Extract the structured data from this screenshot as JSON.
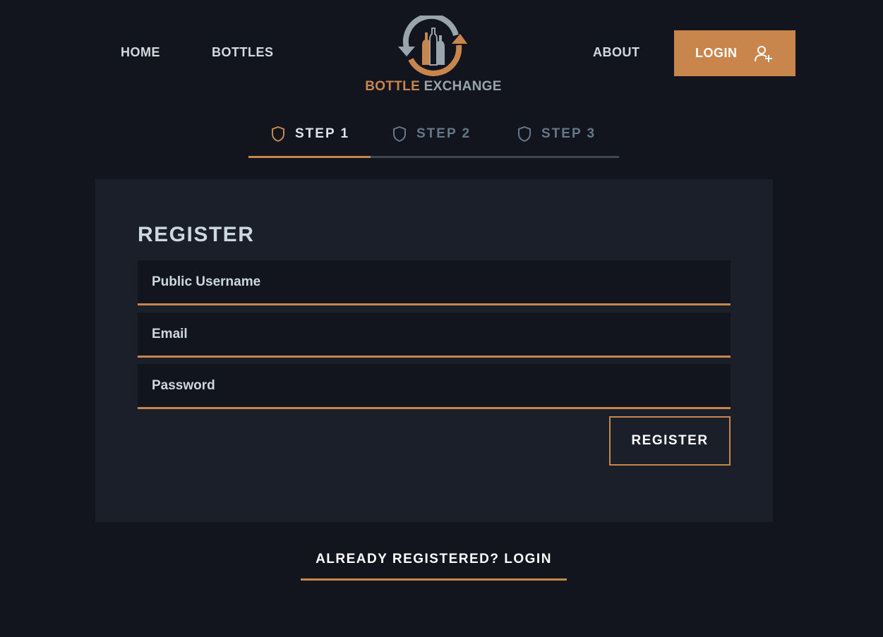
{
  "nav": {
    "home": "HOME",
    "bottles": "BOTTLES",
    "about": "ABOUT",
    "login": "LOGIN"
  },
  "logo": {
    "word1": "BOTTLE",
    "word2": "EXCHANGE"
  },
  "steps": {
    "items": [
      {
        "label": "STEP 1",
        "active": true
      },
      {
        "label": "STEP 2",
        "active": false
      },
      {
        "label": "STEP 3",
        "active": false
      }
    ],
    "progress_fraction": 0.33
  },
  "form": {
    "title": "REGISTER",
    "username_placeholder": "Public Username",
    "email_placeholder": "Email",
    "password_placeholder": "Password",
    "submit_label": "REGISTER"
  },
  "footer": {
    "already_registered": "ALREADY REGISTERED? LOGIN"
  },
  "icons": {
    "login": "user-plus-icon",
    "step": "shield-icon",
    "logo": "bottle-exchange-logo-icon"
  },
  "colors": {
    "background": "#12151d",
    "card": "#1b1f2a",
    "accent": "#c8864c",
    "muted": "#65788a"
  }
}
